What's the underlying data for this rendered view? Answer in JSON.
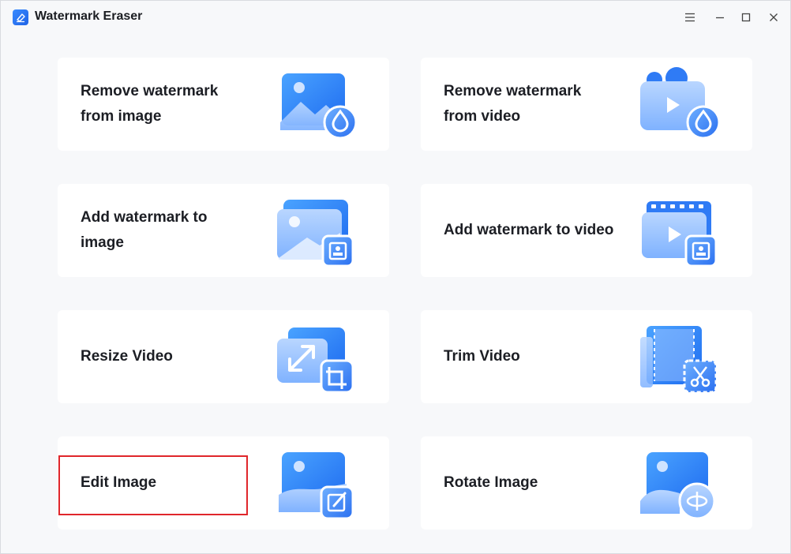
{
  "app": {
    "title": "Watermark Eraser",
    "logo_icon": "eraser-icon",
    "accent_color": "#2f7bf5"
  },
  "window_controls": {
    "menu_icon": "hamburger-menu-icon",
    "minimize_icon": "minimize-icon",
    "maximize_icon": "maximize-icon",
    "close_icon": "close-icon"
  },
  "tools": [
    {
      "id": "remove-watermark-image",
      "label": "Remove watermark\nfrom image",
      "icon": "image-droplet-icon"
    },
    {
      "id": "remove-watermark-video",
      "label": "Remove watermark\nfrom video",
      "icon": "video-droplet-icon"
    },
    {
      "id": "add-watermark-image",
      "label": "Add watermark to\nimage",
      "icon": "image-stamp-icon"
    },
    {
      "id": "add-watermark-video",
      "label": "Add watermark to video",
      "icon": "video-stamp-icon"
    },
    {
      "id": "resize-video",
      "label": "Resize Video",
      "icon": "resize-crop-icon"
    },
    {
      "id": "trim-video",
      "label": "Trim Video",
      "icon": "film-scissors-icon"
    },
    {
      "id": "edit-image",
      "label": "Edit Image",
      "icon": "image-edit-icon"
    },
    {
      "id": "rotate-image",
      "label": "Rotate Image",
      "icon": "image-rotate-icon"
    }
  ],
  "highlight_color": "#e0262b"
}
